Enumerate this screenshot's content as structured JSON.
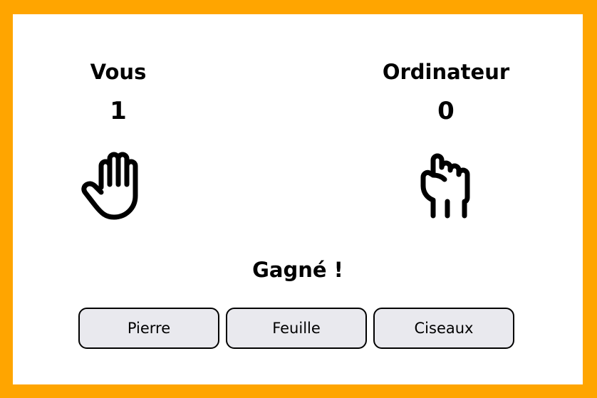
{
  "player": {
    "label": "Vous",
    "score": "1",
    "choice_icon": "open-hand-paper-icon"
  },
  "computer": {
    "label": "Ordinateur",
    "score": "0",
    "choice_icon": "raised-fist-rock-icon"
  },
  "result": "Gagné !",
  "choices": [
    "Pierre",
    "Feuille",
    "Ciseaux"
  ],
  "colors": {
    "border": "#ffa500",
    "button_bg": "#e9e9ee",
    "panel": "#ffffff"
  }
}
